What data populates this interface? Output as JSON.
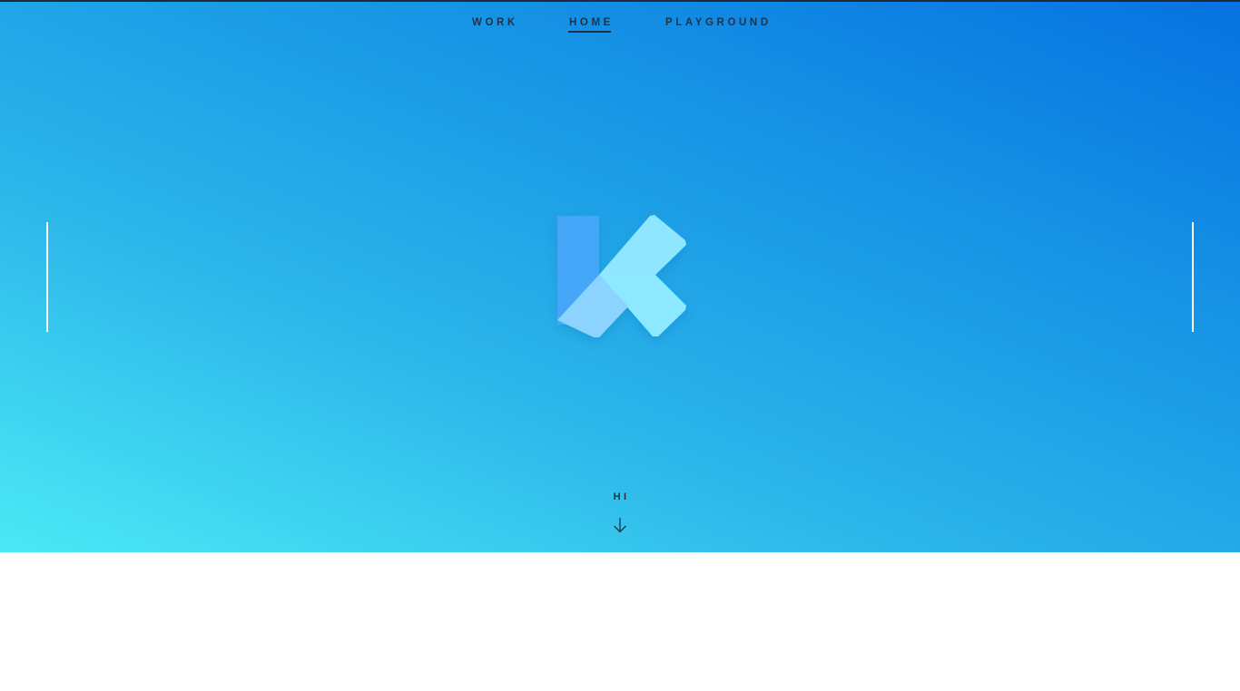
{
  "nav": {
    "items": [
      {
        "label": "WORK"
      },
      {
        "label": "HOME"
      },
      {
        "label": "PLAYGROUND"
      }
    ],
    "active": "HOME"
  },
  "hero": {
    "logo_icon": "k-logo-icon",
    "scroll_label": "HI",
    "scroll_icon": "arrow-down-icon"
  },
  "colors": {
    "gradient_start": "#4be9f6",
    "gradient_end": "#0672e1",
    "nav_text": "#1f3347",
    "logo_bar": "#44a5f7",
    "logo_light": "#8ee6ff",
    "logo_mid": "#8cd4ff"
  }
}
